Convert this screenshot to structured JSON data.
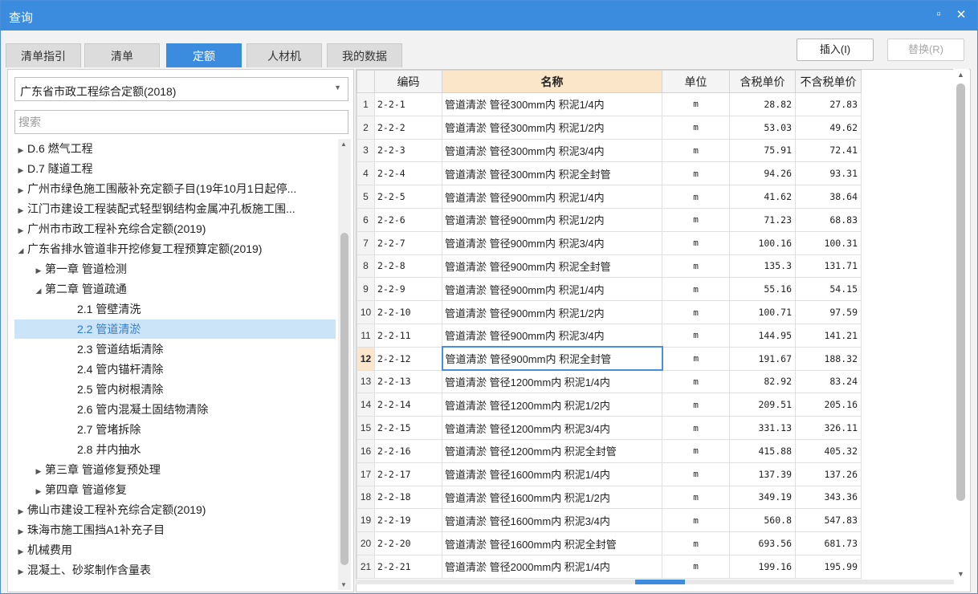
{
  "window": {
    "title": "查询",
    "restore_icon": "restore-icon",
    "close_icon": "close-icon",
    "restore_glyph": "▫",
    "close_glyph": "✕"
  },
  "tabs": [
    {
      "label": "清单指引",
      "active": false
    },
    {
      "label": "清单",
      "active": false
    },
    {
      "label": "定额",
      "active": true
    },
    {
      "label": "人材机",
      "active": false
    },
    {
      "label": "我的数据",
      "active": false
    }
  ],
  "actions": {
    "insert_label": "插入(I)",
    "replace_label": "替换(R)"
  },
  "library": {
    "selected": "广东省市政工程综合定额(2018)"
  },
  "search": {
    "placeholder": "搜索",
    "value": ""
  },
  "tree": [
    {
      "label": "D.6 燃气工程",
      "arrow": "▶",
      "level": 0
    },
    {
      "label": "D.7 隧道工程",
      "arrow": "▶",
      "level": 0
    },
    {
      "label": "广州市绿色施工围蔽补充定额子目(19年10月1日起停...",
      "arrow": "▶",
      "level": 0
    },
    {
      "label": "江门市建设工程装配式轻型钢结构金属冲孔板施工围...",
      "arrow": "▶",
      "level": 0
    },
    {
      "label": "广州市市政工程补充综合定额(2019)",
      "arrow": "▶",
      "level": 0
    },
    {
      "label": "广东省排水管道非开挖修复工程预算定额(2019)",
      "arrow": "◢",
      "level": 0
    },
    {
      "label": "第一章 管道检测",
      "arrow": "▶",
      "level": 1
    },
    {
      "label": "第二章 管道疏通",
      "arrow": "◢",
      "level": 1
    },
    {
      "label": "2.1 管壁清洗",
      "arrow": "",
      "level": 2
    },
    {
      "label": "2.2 管道清淤",
      "arrow": "",
      "level": 2,
      "selected": true
    },
    {
      "label": "2.3 管道结垢清除",
      "arrow": "",
      "level": 2
    },
    {
      "label": "2.4 管内锚杆清除",
      "arrow": "",
      "level": 2
    },
    {
      "label": "2.5 管内树根清除",
      "arrow": "",
      "level": 2
    },
    {
      "label": "2.6 管内混凝土固结物清除",
      "arrow": "",
      "level": 2
    },
    {
      "label": "2.7 管堵拆除",
      "arrow": "",
      "level": 2
    },
    {
      "label": "2.8 井内抽水",
      "arrow": "",
      "level": 2
    },
    {
      "label": "第三章 管道修复预处理",
      "arrow": "▶",
      "level": 1
    },
    {
      "label": "第四章 管道修复",
      "arrow": "▶",
      "level": 1
    },
    {
      "label": "佛山市建设工程补充综合定额(2019)",
      "arrow": "▶",
      "level": 0
    },
    {
      "label": "珠海市施工围挡A1补充子目",
      "arrow": "▶",
      "level": 0
    },
    {
      "label": "机械费用",
      "arrow": "▶",
      "level": 0
    },
    {
      "label": "混凝土、砂浆制作含量表",
      "arrow": "▶",
      "level": 0
    }
  ],
  "grid": {
    "headers": {
      "code": "编码",
      "name": "名称",
      "unit": "单位",
      "price_tax": "含税单价",
      "price_notax": "不含税单价"
    },
    "current_row": 12,
    "rows": [
      {
        "no": "1",
        "code": "2-2-1",
        "name": "管道清淤 管径300mm内 积泥1/4内",
        "unit": "m",
        "p1": "28.82",
        "p2": "27.83"
      },
      {
        "no": "2",
        "code": "2-2-2",
        "name": "管道清淤 管径300mm内 积泥1/2内",
        "unit": "m",
        "p1": "53.03",
        "p2": "49.62"
      },
      {
        "no": "3",
        "code": "2-2-3",
        "name": "管道清淤 管径300mm内 积泥3/4内",
        "unit": "m",
        "p1": "75.91",
        "p2": "72.41"
      },
      {
        "no": "4",
        "code": "2-2-4",
        "name": "管道清淤 管径300mm内 积泥全封管",
        "unit": "m",
        "p1": "94.26",
        "p2": "93.31"
      },
      {
        "no": "5",
        "code": "2-2-5",
        "name": "管道清淤 管径900mm内 积泥1/4内",
        "unit": "m",
        "p1": "41.62",
        "p2": "38.64"
      },
      {
        "no": "6",
        "code": "2-2-6",
        "name": "管道清淤 管径900mm内 积泥1/2内",
        "unit": "m",
        "p1": "71.23",
        "p2": "68.83"
      },
      {
        "no": "7",
        "code": "2-2-7",
        "name": "管道清淤 管径900mm内 积泥3/4内",
        "unit": "m",
        "p1": "100.16",
        "p2": "100.31"
      },
      {
        "no": "8",
        "code": "2-2-8",
        "name": "管道清淤 管径900mm内 积泥全封管",
        "unit": "m",
        "p1": "135.3",
        "p2": "131.71"
      },
      {
        "no": "9",
        "code": "2-2-9",
        "name": "管道清淤 管径900mm内 积泥1/4内",
        "unit": "m",
        "p1": "55.16",
        "p2": "54.15"
      },
      {
        "no": "10",
        "code": "2-2-10",
        "name": "管道清淤 管径900mm内 积泥1/2内",
        "unit": "m",
        "p1": "100.71",
        "p2": "97.59"
      },
      {
        "no": "11",
        "code": "2-2-11",
        "name": "管道清淤 管径900mm内 积泥3/4内",
        "unit": "m",
        "p1": "144.95",
        "p2": "141.21"
      },
      {
        "no": "12",
        "code": "2-2-12",
        "name": "管道清淤 管径900mm内 积泥全封管",
        "unit": "m",
        "p1": "191.67",
        "p2": "188.32"
      },
      {
        "no": "13",
        "code": "2-2-13",
        "name": "管道清淤 管径1200mm内 积泥1/4内",
        "unit": "m",
        "p1": "82.92",
        "p2": "83.24"
      },
      {
        "no": "14",
        "code": "2-2-14",
        "name": "管道清淤 管径1200mm内 积泥1/2内",
        "unit": "m",
        "p1": "209.51",
        "p2": "205.16"
      },
      {
        "no": "15",
        "code": "2-2-15",
        "name": "管道清淤 管径1200mm内 积泥3/4内",
        "unit": "m",
        "p1": "331.13",
        "p2": "326.11"
      },
      {
        "no": "16",
        "code": "2-2-16",
        "name": "管道清淤 管径1200mm内 积泥全封管",
        "unit": "m",
        "p1": "415.88",
        "p2": "405.32"
      },
      {
        "no": "17",
        "code": "2-2-17",
        "name": "管道清淤 管径1600mm内 积泥1/4内",
        "unit": "m",
        "p1": "137.39",
        "p2": "137.26"
      },
      {
        "no": "18",
        "code": "2-2-18",
        "name": "管道清淤 管径1600mm内 积泥1/2内",
        "unit": "m",
        "p1": "349.19",
        "p2": "343.36"
      },
      {
        "no": "19",
        "code": "2-2-19",
        "name": "管道清淤 管径1600mm内 积泥3/4内",
        "unit": "m",
        "p1": "560.8",
        "p2": "547.83"
      },
      {
        "no": "20",
        "code": "2-2-20",
        "name": "管道清淤 管径1600mm内 积泥全封管",
        "unit": "m",
        "p1": "693.56",
        "p2": "681.73"
      },
      {
        "no": "21",
        "code": "2-2-21",
        "name": "管道清淤 管径2000mm内 积泥1/4内",
        "unit": "m",
        "p1": "199.16",
        "p2": "195.99"
      }
    ]
  },
  "colors": {
    "accent": "#3b8cde",
    "header_highlight": "#fbe6c9",
    "selection": "#cce4f7"
  }
}
